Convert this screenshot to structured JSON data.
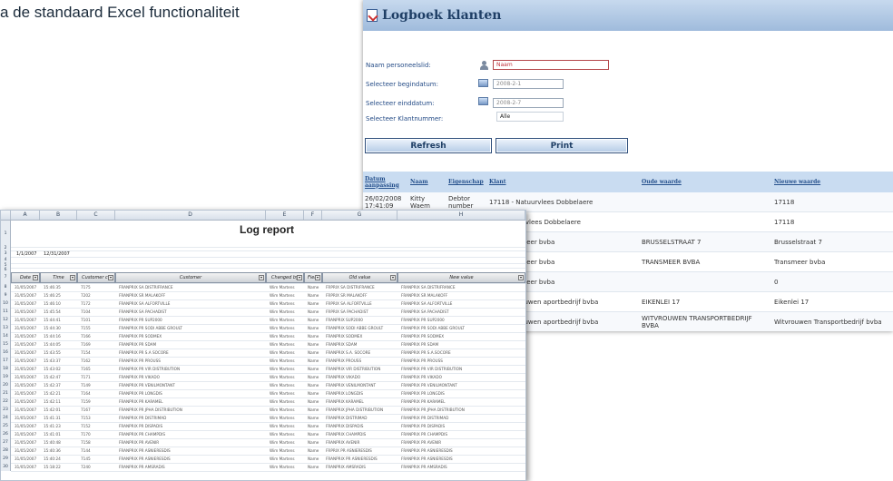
{
  "heading": "a de standaard Excel functionaliteit",
  "web": {
    "title": "Logboek klanten",
    "form": {
      "naam_label": "Naam personeelslid:",
      "naam_value": "Naam",
      "begin_label": "Selecteer begindatum:",
      "begin_value": "2008-2-1",
      "eind_label": "Selecteer einddatum:",
      "eind_value": "2008-2-7",
      "klant_label": "Selecteer Klantnummer:",
      "klant_value": "Alle"
    },
    "buttons": {
      "refresh": "Refresh",
      "print": "Print"
    },
    "table": {
      "headers": [
        "Datum aanpassing",
        "Naam",
        "Eigenschap",
        "Klant",
        "Oude waarde",
        "Nieuwe waarde"
      ],
      "rows": [
        [
          "26/02/2008 17:41:09",
          "Kitty Waem",
          "Debtor number",
          "17118 - Natuurvlees Dobbelaere",
          "",
          "17118"
        ],
        [
          "",
          "",
          "",
          "18 - Natuurvlees Dobbelaere",
          "",
          "17118"
        ],
        [
          "",
          "",
          "",
          "04 - Transmeer bvba",
          "BRUSSELSTRAAT 7",
          "Brusselstraat 7"
        ],
        [
          "",
          "",
          "",
          "04 - Transmeer bvba",
          "TRANSMEER BVBA",
          "Transmeer bvba"
        ],
        [
          "",
          "",
          "",
          "04 - Transmeer bvba",
          "",
          "0"
        ],
        [
          "",
          "",
          "",
          "70 - Witvrouwen aportbedrijf bvba",
          "EIKENLEI 17",
          "Eikenlei 17"
        ],
        [
          "",
          "",
          "",
          "70 - Witvrouwen aportbedrijf bvba",
          "WITVROUWEN TRANSPORTBEDRIJF BVBA",
          "Witvrouwen Transportbedrijf bvba"
        ],
        [
          "",
          "",
          "",
          "70 - Witvrouwen aportbedrijf bvba",
          "",
          "0"
        ]
      ]
    }
  },
  "excel": {
    "col_letters": [
      "A",
      "B",
      "C",
      "D",
      "E",
      "F",
      "G",
      "H"
    ],
    "title": "Log report",
    "date_from": "1/1/2007",
    "date_to": "12/31/2007",
    "headers": [
      "Date",
      "Time",
      "Customer co",
      "Customer",
      "Changed by",
      "Field",
      "Old value",
      "New value"
    ],
    "row_numbers": [
      "1",
      "2",
      "3",
      "4",
      "5",
      "6",
      "7",
      "8",
      "9",
      "10",
      "11",
      "12",
      "13",
      "14",
      "15",
      "16",
      "17",
      "18",
      "19",
      "20",
      "21",
      "22",
      "23",
      "24",
      "25",
      "26",
      "27",
      "28",
      "29",
      "30"
    ],
    "rows": [
      [
        "31/05/2007",
        "15:46:35",
        "7175",
        "FRANPRIX SA DISTRIFRANCE",
        "Wim Martens",
        "Name",
        "FRPRIX SA DISTRIFRANCE",
        "FRANPRIX SA DISTRIFRANCE"
      ],
      [
        "31/05/2007",
        "15:46:25",
        "7202",
        "FRANPRIX SR MALAKOFF",
        "Wim Martens",
        "Name",
        "FRPRIX SR MALAKOFF",
        "FRANPRIX SR MALAKOFF"
      ],
      [
        "31/05/2007",
        "15:46:10",
        "7172",
        "FRANPRIX SA ALFORTVILLE",
        "Wim Martens",
        "Name",
        "FRPRIX SA ALFORTVILLE",
        "FRANPRIX SA ALFORTVILLE"
      ],
      [
        "31/05/2007",
        "15:45:54",
        "7104",
        "FRANPRIX SA PACHADIST",
        "Wim Martens",
        "Name",
        "FRPRIX SA PACHADIST",
        "FRANPRIX SA PACHADIST"
      ],
      [
        "31/05/2007",
        "15:44:41",
        "7101",
        "FRANPRIX PR SUP2000",
        "Wim Martens",
        "Name",
        "FRANPRIX SUP2000",
        "FRANPRIX PR SUP2000"
      ],
      [
        "31/05/2007",
        "15:44:30",
        "7155",
        "FRANPRIX PR SODI ABBE GROULT",
        "Wim Martens",
        "Name",
        "FRANPRIX SODI ABBE GROULT",
        "FRANPRIX PR SODI ABBE GROULT"
      ],
      [
        "31/05/2007",
        "15:44:16",
        "7166",
        "FRANPRIX PR SODMEX",
        "Wim Martens",
        "Name",
        "FRANPRIX SODMEX",
        "FRANPRIX PR SODMEX"
      ],
      [
        "31/05/2007",
        "15:44:05",
        "7169",
        "FRANPRIX PR SDAM",
        "Wim Martens",
        "Name",
        "FRANPRIX SDAM",
        "FRANPRIX PR SDAM"
      ],
      [
        "31/05/2007",
        "15:43:55",
        "7154",
        "FRANPRIX PR S.A SOCORE",
        "Wim Martens",
        "Name",
        "FRANPRIX S.A. SOCORE",
        "FRANPRIX PR S.A.SOCORE"
      ],
      [
        "31/05/2007",
        "15:43:37",
        "7162",
        "FRANPRIX PR PROUSS",
        "Wim Martens",
        "Name",
        "FRANPRIX PROUSS",
        "FRANPRIX PR PROUSS"
      ],
      [
        "31/05/2007",
        "15:43:02",
        "7165",
        "FRANPRIX PR VIR DISTRIBUTION",
        "Wim Martens",
        "Name",
        "FRANPRIX VIR DISTRIBUTION",
        "FRANPRIX PR VIR DISTRIBUTION"
      ],
      [
        "31/05/2007",
        "15:42:47",
        "7171",
        "FRANPRIX PR VIKADO",
        "Wim Martens",
        "Name",
        "FRANPRIX VIKADO",
        "FRANPRIX PR VIKADO"
      ],
      [
        "31/05/2007",
        "15:42:37",
        "7149",
        "FRANPRIX PR VENILMONTANT",
        "Wim Martens",
        "Name",
        "FRANPRIX VENILMONTANT",
        "FRANPRIX PR VENILMONTANT"
      ],
      [
        "31/05/2007",
        "15:42:21",
        "7164",
        "FRANPRIX PR LONGDIS",
        "Wim Martens",
        "Name",
        "FRANPRIX LONGDIS",
        "FRANPRIX PR LONGDIS"
      ],
      [
        "31/05/2007",
        "15:42:11",
        "7159",
        "FRANPRIX PR KARAMEL",
        "Wim Martens",
        "Name",
        "FRANPRIX KARAMEL",
        "FRANPRIX PR KARAMEL"
      ],
      [
        "31/05/2007",
        "15:42:01",
        "7167",
        "FRANPRIX PR JPHA DISTRIBUTION",
        "Wim Martens",
        "Name",
        "FRANPRIX JPHA DISTRIBUTION",
        "FRANPRIX PR JPHA DISTRIBUTION"
      ],
      [
        "31/05/2007",
        "15:41:31",
        "7153",
        "FRANPRIX PR DISTRIMAD",
        "Wim Martens",
        "Name",
        "FRANPRIX DISTRIMAD",
        "FRANPRIX PR DISTRIMAD"
      ],
      [
        "31/05/2007",
        "15:41:23",
        "7152",
        "FRANPRIX PR DISPADIS",
        "Wim Martens",
        "Name",
        "FRANPRIX DISPADIS",
        "FRANPRIX PR DISPADIS"
      ],
      [
        "31/05/2007",
        "15:41:01",
        "7170",
        "FRANPRIX PR CHAMPDIS",
        "Wim Martens",
        "Name",
        "FRANPRIX CHAMPDIS",
        "FRANPRIX PR CHAMPDIS"
      ],
      [
        "31/05/2007",
        "15:40:48",
        "7158",
        "FRANPRIX PR AVENIR",
        "Wim Martens",
        "Name",
        "FRANPRIX AVENIR",
        "FRANPRIX PR AVENIR"
      ],
      [
        "31/05/2007",
        "15:40:36",
        "7144",
        "FRANPRIX PR ASNIERESDIS",
        "Wim Martens",
        "Name",
        "FRPRIX PR ASNIERESDIS",
        "FRANPRIX PR ASNIERESDIS"
      ],
      [
        "31/05/2007",
        "15:40:24",
        "7145",
        "FRANPRIX PR ASNIERESDIS",
        "Wim Martens",
        "Name",
        "FRANPRIX PR ASNIERESDIS",
        "FRANPRIX PR ASNIERESDIS"
      ],
      [
        "31/05/2007",
        "15:18:22",
        "7240",
        "FRANPRIX PR AMSRADIS",
        "Wim Martens",
        "Name",
        "FRANPRIX AMSRADIS",
        "FRANPRIX PR AMSRADIS"
      ]
    ]
  },
  "colors": {
    "accent": "#1f3f66",
    "header_bg": "#c9dcf1",
    "link": "#25508c"
  }
}
